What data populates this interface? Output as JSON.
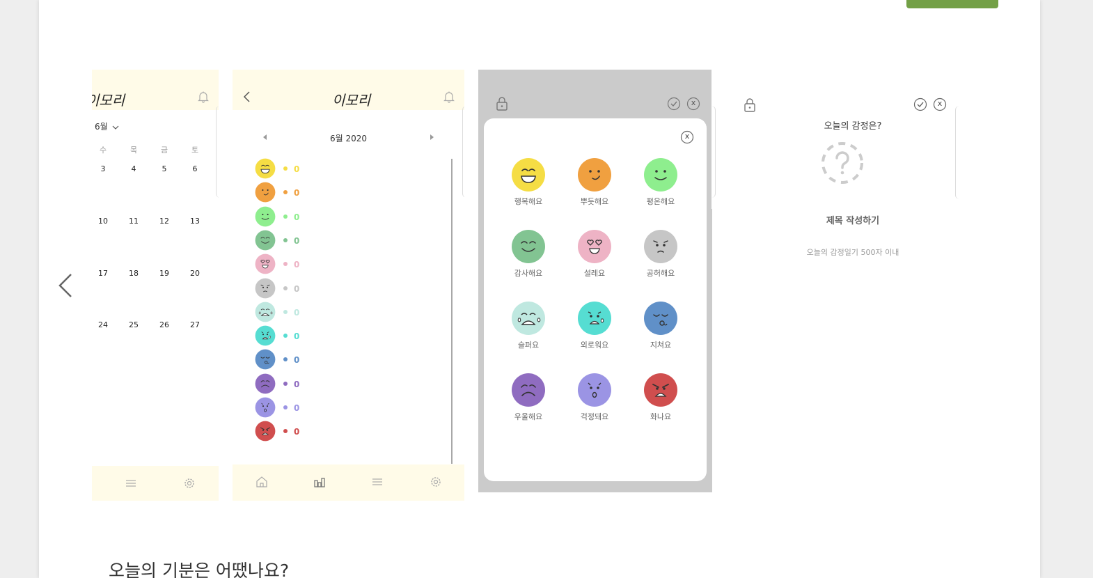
{
  "app": {
    "logo": "이모리"
  },
  "page": {
    "bottom_heading": "오늘의 기분은 어땠나요?",
    "accent_color": "#73a046"
  },
  "screen_calendar": {
    "month_label": "6월",
    "weekdays": [
      "수",
      "목",
      "금",
      "토"
    ],
    "weeks": [
      [
        "3",
        "4",
        "5",
        "6"
      ],
      [
        "10",
        "11",
        "12",
        "13"
      ],
      [
        "17",
        "18",
        "19",
        "20"
      ],
      [
        "24",
        "25",
        "26",
        "27"
      ]
    ],
    "nav_icons": [
      "menu-icon",
      "gear-icon"
    ]
  },
  "screen_stats": {
    "month_title": "6월 2020",
    "prev_icon": "triangle-left-icon",
    "next_icon": "triangle-right-icon",
    "stats": [
      {
        "emotion": "행복해요",
        "count": "0",
        "color": "#f5dd44"
      },
      {
        "emotion": "뿌듯해요",
        "count": "0",
        "color": "#f0a040"
      },
      {
        "emotion": "평온해요",
        "count": "0",
        "color": "#8eee8e"
      },
      {
        "emotion": "감사해요",
        "count": "0",
        "color": "#82c492"
      },
      {
        "emotion": "설레요",
        "count": "0",
        "color": "#eeb3c5"
      },
      {
        "emotion": "공허해요",
        "count": "0",
        "color": "#c6c6c6"
      },
      {
        "emotion": "슬퍼요",
        "count": "0",
        "color": "#bfe8e0"
      },
      {
        "emotion": "외로워요",
        "count": "0",
        "color": "#56ddd2"
      },
      {
        "emotion": "지쳐요",
        "count": "0",
        "color": "#6090c8"
      },
      {
        "emotion": "우울해요",
        "count": "0",
        "color": "#8f6cc0"
      },
      {
        "emotion": "걱정돼요",
        "count": "0",
        "color": "#9b94e4"
      },
      {
        "emotion": "화나요",
        "count": "0",
        "color": "#d04e4e"
      }
    ],
    "nav_icons": [
      "home-icon",
      "chart-icon",
      "menu-icon",
      "gear-icon"
    ]
  },
  "screen_picker": {
    "emotions": [
      {
        "label": "행복해요",
        "color": "#f5dd44"
      },
      {
        "label": "뿌듯해요",
        "color": "#f0a040"
      },
      {
        "label": "평온해요",
        "color": "#8eee8e"
      },
      {
        "label": "감사해요",
        "color": "#82c492"
      },
      {
        "label": "설레요",
        "color": "#eeb3c5"
      },
      {
        "label": "공허해요",
        "color": "#c6c6c6"
      },
      {
        "label": "슬퍼요",
        "color": "#bfe8e0"
      },
      {
        "label": "외로워요",
        "color": "#56ddd2"
      },
      {
        "label": "지쳐요",
        "color": "#6090c8"
      },
      {
        "label": "우울해요",
        "color": "#8f6cc0"
      },
      {
        "label": "걱정돼요",
        "color": "#9b94e4"
      },
      {
        "label": "화나요",
        "color": "#d04e4e"
      }
    ],
    "close_glyph": "x"
  },
  "screen_entry": {
    "question": "오늘의 감정은?",
    "title_placeholder": "제목 작성하기",
    "body_hint": "오늘의 감정일기 500자 이내",
    "check_icon": "check-circle-icon",
    "close_glyph": "x"
  }
}
